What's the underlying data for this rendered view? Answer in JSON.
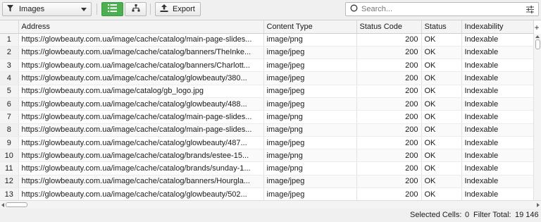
{
  "toolbar": {
    "filter_label": "Images",
    "export_label": "Export",
    "search_placeholder": "Search...",
    "accent_color": "#4cb050"
  },
  "table": {
    "headers": [
      "Address",
      "Content Type",
      "Status Code",
      "Status",
      "Indexability"
    ],
    "rows": [
      {
        "num": "1",
        "address": "https://glowbeauty.com.ua/image/cache/catalog/main-page-slides...",
        "type": "image/png",
        "code": "200",
        "status": "OK",
        "indexability": "Indexable"
      },
      {
        "num": "2",
        "address": "https://glowbeauty.com.ua/image/cache/catalog/banners/TheInke...",
        "type": "image/jpeg",
        "code": "200",
        "status": "OK",
        "indexability": "Indexable"
      },
      {
        "num": "3",
        "address": "https://glowbeauty.com.ua/image/cache/catalog/banners/Charlott...",
        "type": "image/jpeg",
        "code": "200",
        "status": "OK",
        "indexability": "Indexable"
      },
      {
        "num": "4",
        "address": "https://glowbeauty.com.ua/image/cache/catalog/glowbeauty/380...",
        "type": "image/jpeg",
        "code": "200",
        "status": "OK",
        "indexability": "Indexable"
      },
      {
        "num": "5",
        "address": "https://glowbeauty.com.ua/image/catalog/gb_logo.jpg",
        "type": "image/jpeg",
        "code": "200",
        "status": "OK",
        "indexability": "Indexable"
      },
      {
        "num": "6",
        "address": "https://glowbeauty.com.ua/image/cache/catalog/glowbeauty/488...",
        "type": "image/jpeg",
        "code": "200",
        "status": "OK",
        "indexability": "Indexable"
      },
      {
        "num": "7",
        "address": "https://glowbeauty.com.ua/image/cache/catalog/main-page-slides...",
        "type": "image/png",
        "code": "200",
        "status": "OK",
        "indexability": "Indexable"
      },
      {
        "num": "8",
        "address": "https://glowbeauty.com.ua/image/cache/catalog/main-page-slides...",
        "type": "image/png",
        "code": "200",
        "status": "OK",
        "indexability": "Indexable"
      },
      {
        "num": "9",
        "address": "https://glowbeauty.com.ua/image/cache/catalog/glowbeauty/487...",
        "type": "image/jpeg",
        "code": "200",
        "status": "OK",
        "indexability": "Indexable"
      },
      {
        "num": "10",
        "address": "https://glowbeauty.com.ua/image/cache/catalog/brands/estee-15...",
        "type": "image/png",
        "code": "200",
        "status": "OK",
        "indexability": "Indexable"
      },
      {
        "num": "11",
        "address": "https://glowbeauty.com.ua/image/cache/catalog/brands/sunday-1...",
        "type": "image/png",
        "code": "200",
        "status": "OK",
        "indexability": "Indexable"
      },
      {
        "num": "12",
        "address": "https://glowbeauty.com.ua/image/cache/catalog/banners/Hourgla...",
        "type": "image/jpeg",
        "code": "200",
        "status": "OK",
        "indexability": "Indexable"
      },
      {
        "num": "13",
        "address": "https://glowbeauty.com.ua/image/cache/catalog/glowbeauty/502...",
        "type": "image/jpeg",
        "code": "200",
        "status": "OK",
        "indexability": "Indexable"
      }
    ]
  },
  "status_bar": {
    "selected_cells_label": "Selected Cells:",
    "selected_cells": "0",
    "filter_total_label": "Filter Total:",
    "filter_total": "19 146"
  }
}
